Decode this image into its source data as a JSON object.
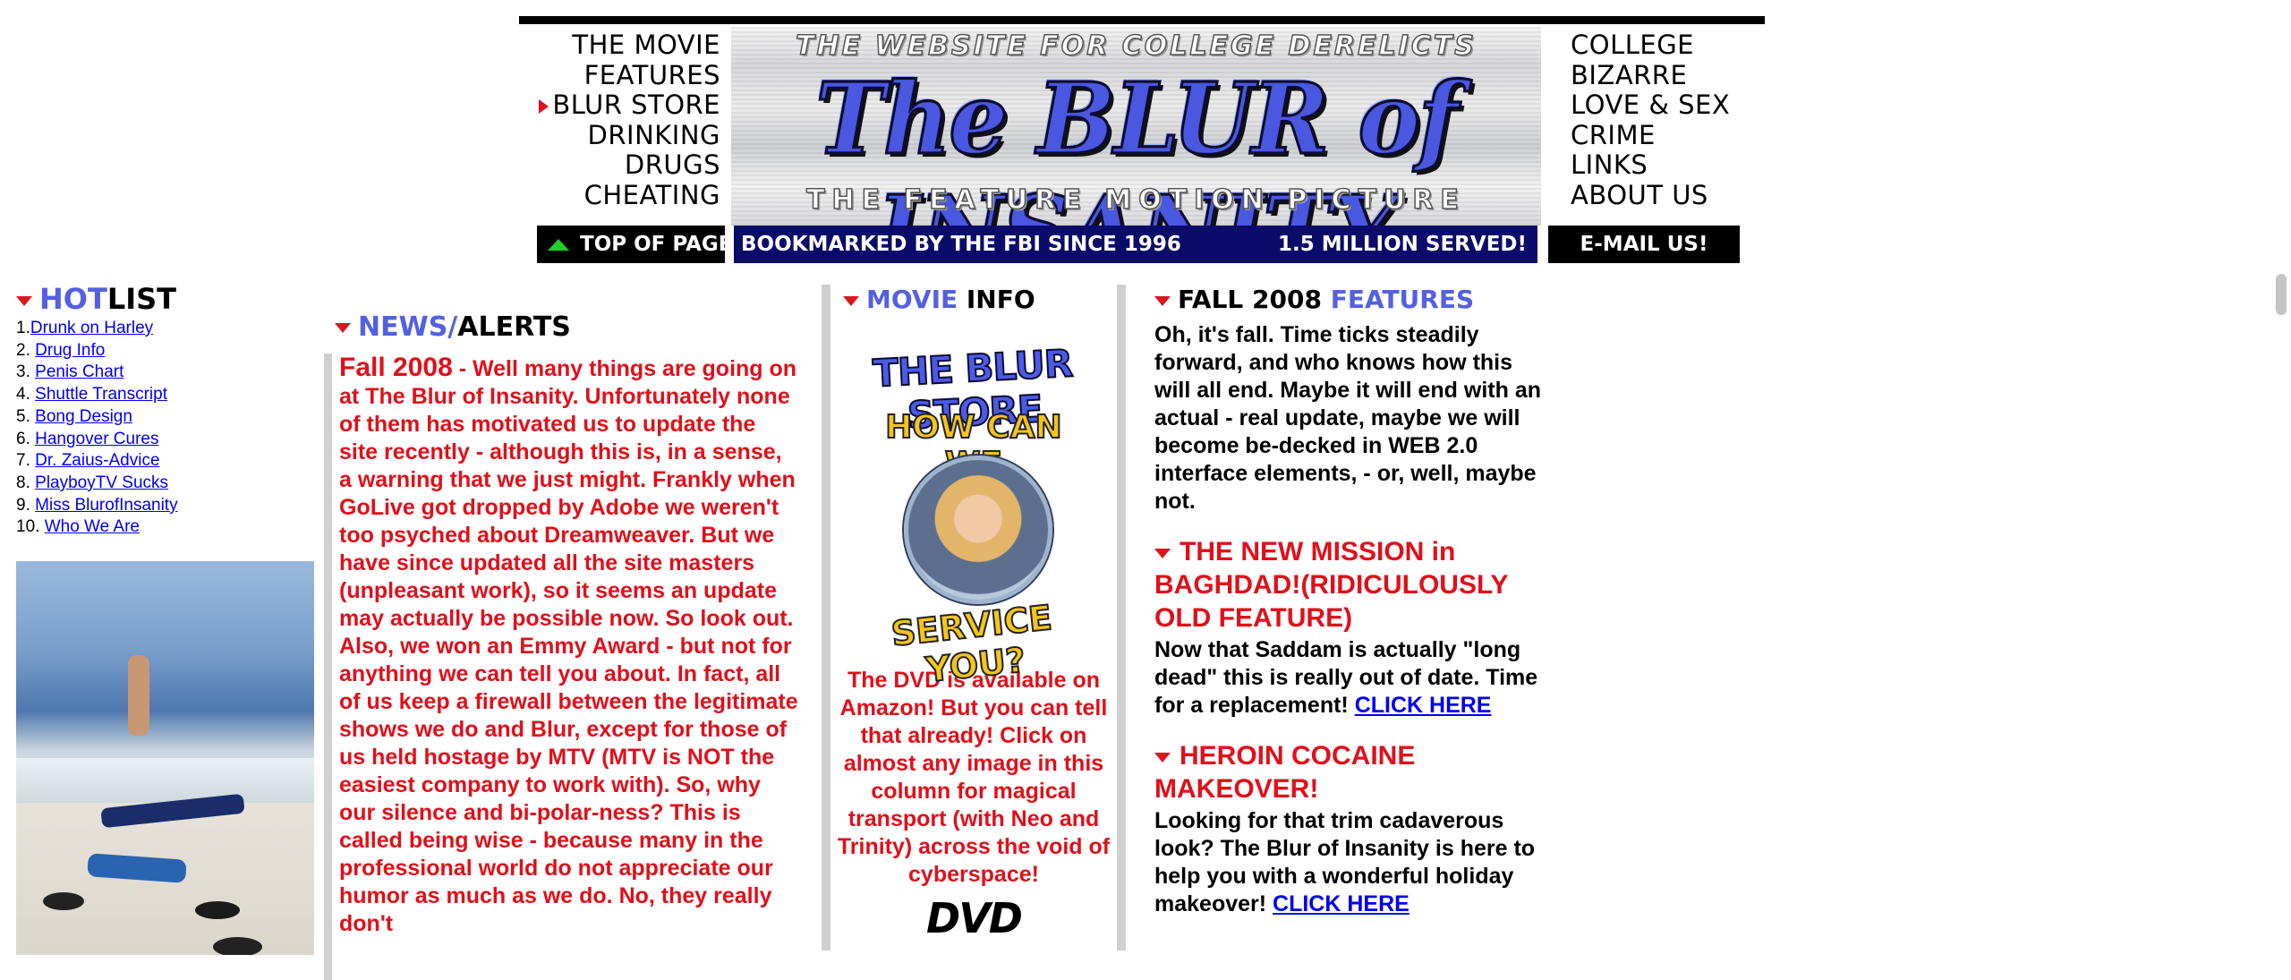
{
  "nav_left": [
    "THE MOVIE",
    "FEATURES",
    "BLUR STORE",
    "DRINKING",
    "DRUGS",
    "CHEATING"
  ],
  "nav_right": [
    "COLLEGE",
    "BIZARRE",
    "LOVE & SEX",
    "CRIME",
    "LINKS",
    "ABOUT US"
  ],
  "banner": {
    "tagline": "THE WEBSITE FOR COLLEGE DERELICTS",
    "title": "The BLUR of INSANITY",
    "subtitle": "THE FEATURE MOTION PICTURE"
  },
  "buttons": {
    "top_of_page": "TOP OF PAGE",
    "fbi": "BOOKMARKED BY THE FBI SINCE 1996",
    "served": "1.5 MILLION SERVED!",
    "email": "E-MAIL US!"
  },
  "hotlist": {
    "title_a": "HOT",
    "title_b": "LIST",
    "items": [
      {
        "num": "1.",
        "label": "Drunk on Harley"
      },
      {
        "num": "2.",
        "label": "Drug Info"
      },
      {
        "num": "3.",
        "label": "Penis Chart"
      },
      {
        "num": "4.",
        "label": "Shuttle Transcript"
      },
      {
        "num": "5.",
        "label": "Bong Design"
      },
      {
        "num": "6.",
        "label": "Hangover Cures"
      },
      {
        "num": "7.",
        "label": "Dr. Zaius-Advice"
      },
      {
        "num": "8.",
        "label": "PlayboyTV Sucks"
      },
      {
        "num": "9.",
        "label": "Miss BlurofInsanity"
      },
      {
        "num": "10.",
        "label": "Who We Are"
      }
    ]
  },
  "news": {
    "head_a": "NEWS/",
    "head_b": "ALERTS",
    "date": "Fall 2008",
    "body": " - Well many things are going on at The Blur of Insanity. Unfortunately none of them has motivated us to update the site recently - although this is, in a sense, a warning that we just might. Frankly when GoLive got dropped by Adobe we weren't too psyched about Dreamweaver. But we have since updated all the site masters (unpleasant work), so it seems an update may actually be possible now. So look out. Also, we won an Emmy Award - but not for anything we can tell you about. In fact, all of us keep a firewall between the legitimate shows we do and Blur, except for those of us held hostage by MTV (MTV is NOT the easiest company to work with). So, why our silence and bi-polar-ness? This is called being wise - because many in the professional world do not appreciate our humor as much as we do. No, they really don't"
  },
  "movie": {
    "head_a": "MOVIE",
    "head_b": "INFO",
    "store_top": "THE BLUR STORE",
    "store_arc1": "HOW CAN WE",
    "store_arc2": "SERVICE YOU?",
    "text": "The DVD is available on Amazon! But you can tell that already! Click on almost any image in this column for magical transport (with Neo and Trinity) across the void of cyberspace!",
    "dvd": "DVD"
  },
  "features": {
    "head_a": "FALL 2008",
    "head_b": "FEATURES",
    "intro": "Oh, it's fall. Time ticks steadily forward, and who knows how this will all end. Maybe it will end with an actual - real update, maybe we will become be-decked in WEB 2.0 interface elements, - or, well, maybe not.",
    "items": [
      {
        "title": "THE NEW MISSION in BAGHDAD!(RIDICULOUSLY OLD FEATURE)",
        "body": "Now that Saddam is actually \"long dead\" this is really out of date. Time for a replacement! ",
        "link": "CLICK HERE"
      },
      {
        "title": "HEROIN COCAINE MAKEOVER!",
        "body": "Looking for that trim cadaverous look? The Blur of Insanity is here to help you with a wonderful holiday makeover! ",
        "link": "CLICK HERE"
      }
    ]
  },
  "colors": {
    "accent_red": "#e0101a",
    "accent_blue": "#5460e0",
    "fbi_bar": "#0b0b6a",
    "up_arrow": "#1ed02a"
  }
}
